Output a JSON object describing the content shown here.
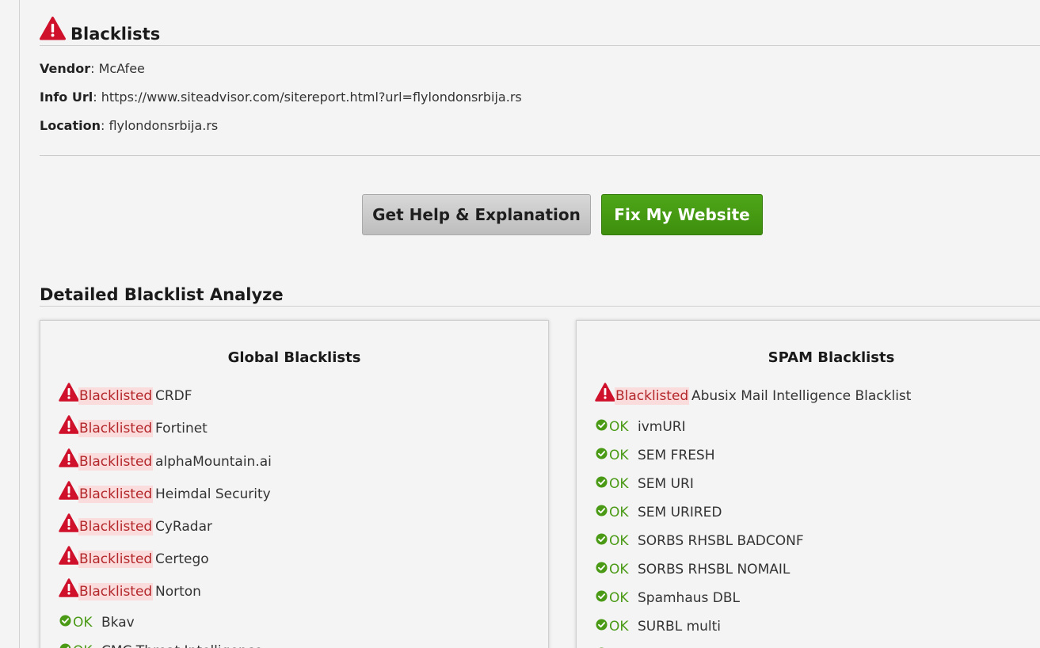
{
  "section": {
    "title": "Blacklists",
    "vendor_label": "Vendor",
    "vendor_value": "McAfee",
    "info_url_label": "Info Url",
    "info_url_value": "https://www.siteadvisor.com/sitereport.html?url=flylondonsrbija.rs",
    "location_label": "Location",
    "location_value": "flylondonsrbija.rs"
  },
  "buttons": {
    "help_label": "Get Help & Explanation",
    "fix_label": "Fix My Website"
  },
  "detailed": {
    "title": "Detailed Blacklist Analyze"
  },
  "global": {
    "title": "Global Blacklists",
    "rows": [
      {
        "status": "Blacklisted",
        "name": "CRDF"
      },
      {
        "status": "Blacklisted",
        "name": "Fortinet"
      },
      {
        "status": "Blacklisted",
        "name": "alphaMountain.ai"
      },
      {
        "status": "Blacklisted",
        "name": "Heimdal Security"
      },
      {
        "status": "Blacklisted",
        "name": "CyRadar"
      },
      {
        "status": "Blacklisted",
        "name": "Certego"
      },
      {
        "status": "Blacklisted",
        "name": "Norton"
      },
      {
        "status": "OK",
        "name": "Bkav"
      },
      {
        "status": "OK",
        "name": "CMC Threat Intelligence"
      }
    ]
  },
  "spam": {
    "title": "SPAM Blacklists",
    "rows": [
      {
        "status": "Blacklisted",
        "name": "Abusix Mail Intelligence Blacklist"
      },
      {
        "status": "OK",
        "name": "ivmURI"
      },
      {
        "status": "OK",
        "name": "SEM FRESH"
      },
      {
        "status": "OK",
        "name": "SEM URI"
      },
      {
        "status": "OK",
        "name": "SEM URIRED"
      },
      {
        "status": "OK",
        "name": "SORBS RHSBL BADCONF"
      },
      {
        "status": "OK",
        "name": "SORBS RHSBL NOMAIL"
      },
      {
        "status": "OK",
        "name": "Spamhaus DBL"
      },
      {
        "status": "OK",
        "name": "SURBL multi"
      },
      {
        "status": "OK",
        "name": ""
      }
    ]
  },
  "colors": {
    "danger": "#d0112b",
    "ok_green": "#4a9a16",
    "fix_button": "#43990f",
    "blacklisted_bg": "#fbdcdc"
  },
  "icons": {
    "warning": "warning-triangle-icon",
    "ok": "check-circle-icon"
  }
}
